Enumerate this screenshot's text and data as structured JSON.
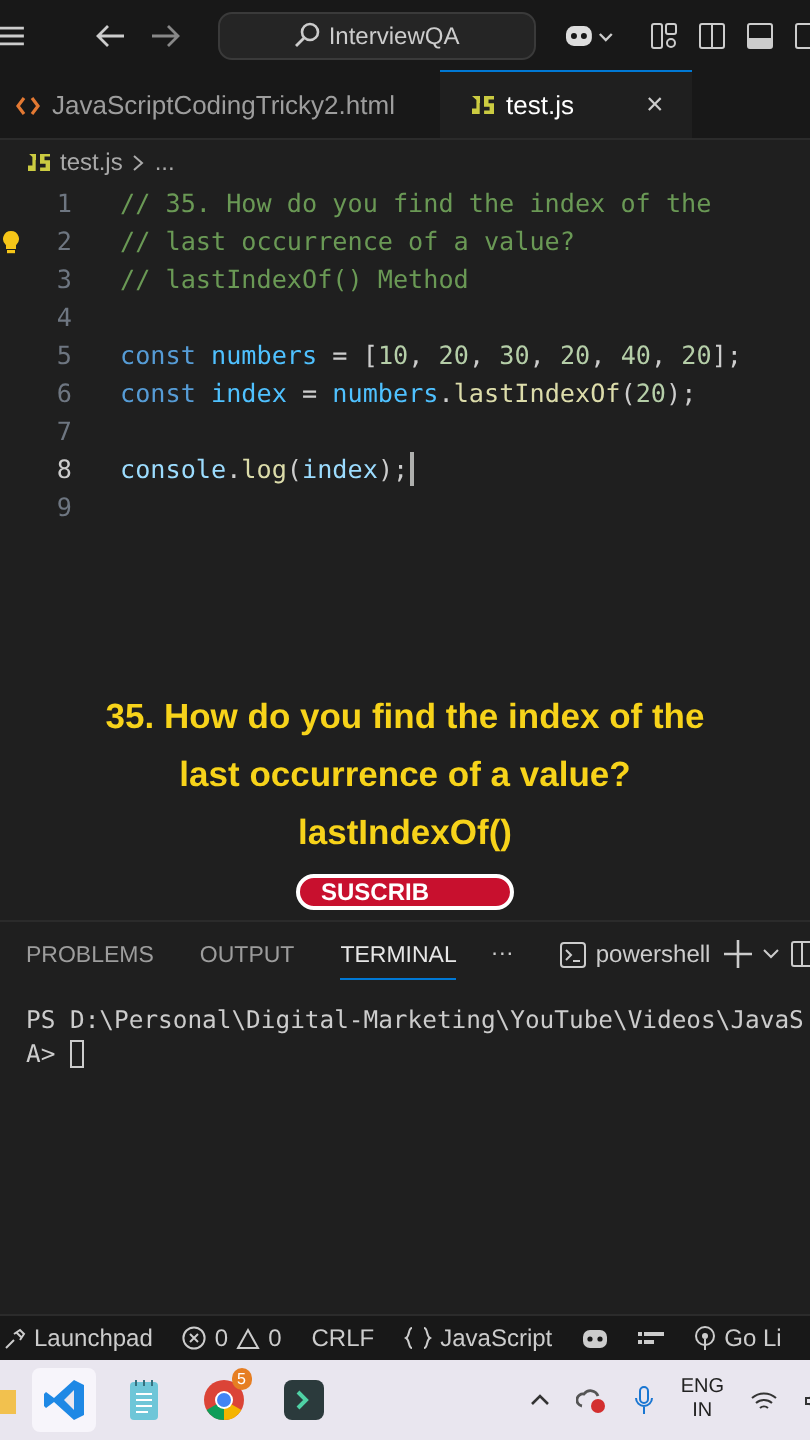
{
  "title_bar": {
    "search": "InterviewQA"
  },
  "editor_tabs": [
    {
      "label": "JavaScriptCodingTricky2.html",
      "kind": "html",
      "selected": false
    },
    {
      "label": "test.js",
      "kind": "js",
      "selected": true,
      "close": "×"
    }
  ],
  "breadcrumb": {
    "file": "test.js",
    "rest": "..."
  },
  "code_lines": [
    {
      "number": "1",
      "active": false,
      "lightbulb": false,
      "tokens": [
        {
          "text": "// 35. How do you find the index of the",
          "kind": "comment"
        }
      ]
    },
    {
      "number": "2",
      "active": false,
      "lightbulb": true,
      "tokens": [
        {
          "text": "// last occurrence of a value?",
          "kind": "comment"
        }
      ]
    },
    {
      "number": "3",
      "active": false,
      "lightbulb": false,
      "tokens": [
        {
          "text": "// lastIndexOf() Method",
          "kind": "comment"
        }
      ]
    },
    {
      "number": "4",
      "active": false,
      "lightbulb": false
    },
    {
      "number": "5",
      "active": false,
      "lightbulb": false,
      "tokens": [
        {
          "text": "const",
          "kind": "keyword"
        },
        {
          "text": " numbers",
          "kind": "constant"
        },
        {
          "text": " = [",
          "kind": "plain"
        },
        {
          "text": "10",
          "kind": "number"
        },
        {
          "text": ", ",
          "kind": "plain"
        },
        {
          "text": "20",
          "kind": "number"
        },
        {
          "text": ", ",
          "kind": "plain"
        },
        {
          "text": "30",
          "kind": "number"
        },
        {
          "text": ", ",
          "kind": "plain"
        },
        {
          "text": "20",
          "kind": "number"
        },
        {
          "text": ", ",
          "kind": "plain"
        },
        {
          "text": "40",
          "kind": "number"
        },
        {
          "text": ", ",
          "kind": "plain"
        },
        {
          "text": "20",
          "kind": "number"
        },
        {
          "text": "];",
          "kind": "plain"
        }
      ]
    },
    {
      "number": "6",
      "active": false,
      "lightbulb": false,
      "tokens": [
        {
          "text": "const",
          "kind": "keyword"
        },
        {
          "text": " index",
          "kind": "constant"
        },
        {
          "text": " = ",
          "kind": "plain"
        },
        {
          "text": "numbers",
          "kind": "constant"
        },
        {
          "text": ".",
          "kind": "plain"
        },
        {
          "text": "lastIndexOf",
          "kind": "function"
        },
        {
          "text": "(",
          "kind": "plain"
        },
        {
          "text": "20",
          "kind": "number"
        },
        {
          "text": ");",
          "kind": "plain"
        }
      ]
    },
    {
      "number": "7",
      "active": false,
      "lightbulb": false
    },
    {
      "number": "8",
      "active": true,
      "lightbulb": false,
      "tokens": [
        {
          "text": "console",
          "kind": "variable"
        },
        {
          "text": ".",
          "kind": "plain"
        },
        {
          "text": "log",
          "kind": "function"
        },
        {
          "text": "(",
          "kind": "plain"
        },
        {
          "text": "index",
          "kind": "variable"
        },
        {
          "text": ");",
          "kind": "plain"
        }
      ]
    },
    {
      "number": "9",
      "active": false,
      "lightbulb": false
    }
  ],
  "overlay_caption": [
    "35. How do you find the index of the",
    "last occurrence of a value?",
    "lastIndexOf()"
  ],
  "subscribe_badge": "SUSCRIB",
  "panel_tabs": [
    {
      "label": "PROBLEMS",
      "selected": false
    },
    {
      "label": "OUTPUT",
      "selected": false
    },
    {
      "label": "TERMINAL",
      "selected": true
    }
  ],
  "panel_more": "···",
  "terminal_name": "powershell",
  "terminal_lines": [
    "PS D:\\Personal\\Digital-Marketing\\YouTube\\Videos\\JavaS",
    "A>"
  ],
  "status_bar": [
    {
      "kind": "launchpad",
      "text": "Launchpad"
    },
    {
      "kind": "problems",
      "errors": "0",
      "warnings": "0"
    },
    {
      "kind": "text",
      "text": "CRLF"
    },
    {
      "kind": "language",
      "text": "JavaScript"
    },
    {
      "kind": "copilot"
    },
    {
      "kind": "layout"
    },
    {
      "kind": "golive",
      "text": "Go Li"
    }
  ],
  "taskbar": {
    "chrome_badge": "5",
    "language": "ENG",
    "region": "IN"
  }
}
